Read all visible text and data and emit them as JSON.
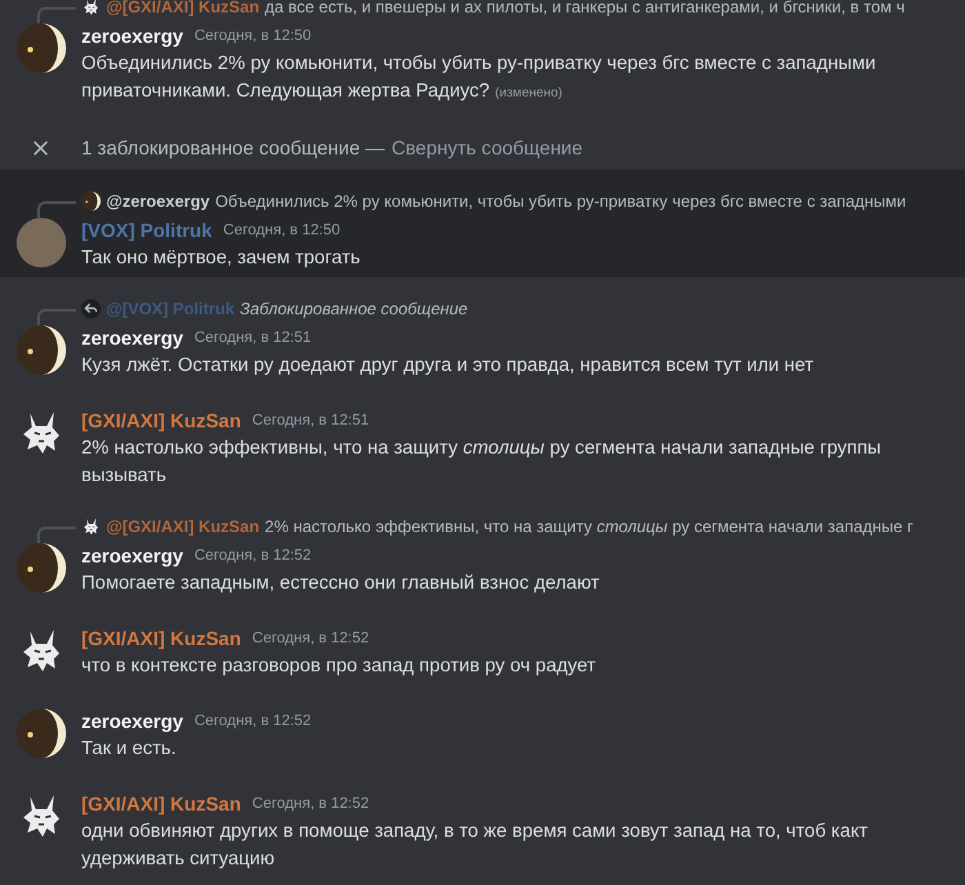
{
  "messages": [
    {
      "kind": "message",
      "highlighted": false,
      "avatar": {
        "kind": "moon"
      },
      "author": "zeroexergy",
      "color": "#f2f3f5",
      "timestamp": "Сегодня, в 12:50",
      "text": "Объединились 2% ру комьюнити, чтобы убить ру-приватку  через бгс вместе с западными приваточниками. Следующая жертва Радиус?",
      "edited": "(изменено)",
      "reply": {
        "kind": "normal",
        "avatar": {
          "kind": "lynx"
        },
        "author": "@[GXI/AXI] KuzSan",
        "color": "#b3663a",
        "text": "да все есть, и пвешеры и ах пилоты, и ганкеры с антиганкерами, и бгсники, в том ч"
      }
    },
    {
      "kind": "blocked_notice",
      "text": "1 заблокированное сообщение —",
      "link": "Свернуть сообщение"
    },
    {
      "kind": "message",
      "highlighted": true,
      "avatar": {
        "kind": "photo"
      },
      "author": "[VOX] Politruk",
      "color": "#4f74a8",
      "timestamp": "Сегодня, в 12:50",
      "text": "Так оно мёртвое, зачем трогать",
      "reply": {
        "kind": "normal",
        "avatar": {
          "kind": "moon"
        },
        "author": "@zeroexergy",
        "color": "#c9ccd1",
        "text": "Объединились 2% ру комьюнити, чтобы убить ру-приватку через бгс вместе с западными"
      }
    },
    {
      "kind": "message",
      "highlighted": false,
      "avatar": {
        "kind": "moon"
      },
      "author": "zeroexergy",
      "color": "#f2f3f5",
      "timestamp": "Сегодня, в 12:51",
      "text": "Кузя лжёт. Остатки ру доедают друг друга и это правда, нравится всем тут или нет",
      "reply": {
        "kind": "blocked",
        "author": "@[VOX] Politruk",
        "color": "#3d5a82",
        "text": "Заблокированное сообщение"
      }
    },
    {
      "kind": "message",
      "highlighted": false,
      "avatar": {
        "kind": "lynx"
      },
      "author": "[GXI/AXI] KuzSan",
      "color": "#d4773f",
      "timestamp": "Сегодня, в 12:51",
      "text": "2% настолько эффективны, что на защиту *столицы* ру сегмента начали западные группы вызывать"
    },
    {
      "kind": "message",
      "highlighted": false,
      "avatar": {
        "kind": "moon"
      },
      "author": "zeroexergy",
      "color": "#f2f3f5",
      "timestamp": "Сегодня, в 12:52",
      "text": "Помогаете западным, естесcно они главный взнос делают",
      "reply": {
        "kind": "normal",
        "avatar": {
          "kind": "lynx"
        },
        "author": "@[GXI/AXI] KuzSan",
        "color": "#b3663a",
        "text": "2% настолько эффективны, что на защиту *столицы* ру сегмента начали западные г"
      }
    },
    {
      "kind": "message",
      "highlighted": false,
      "avatar": {
        "kind": "lynx"
      },
      "author": "[GXI/AXI] KuzSan",
      "color": "#d4773f",
      "timestamp": "Сегодня, в 12:52",
      "text": "что в контексте разговоров про запад против ру оч радует"
    },
    {
      "kind": "message",
      "highlighted": false,
      "avatar": {
        "kind": "moon"
      },
      "author": "zeroexergy",
      "color": "#f2f3f5",
      "timestamp": "Сегодня, в 12:52",
      "text": "Так и есть."
    },
    {
      "kind": "message",
      "highlighted": false,
      "avatar": {
        "kind": "lynx"
      },
      "author": "[GXI/AXI] KuzSan",
      "color": "#d4773f",
      "timestamp": "Сегодня, в 12:52",
      "text": "одни обвиняют других в помоще западу, в то же время сами зовут запад на то, чтоб какт удерживать ситуацию"
    }
  ]
}
